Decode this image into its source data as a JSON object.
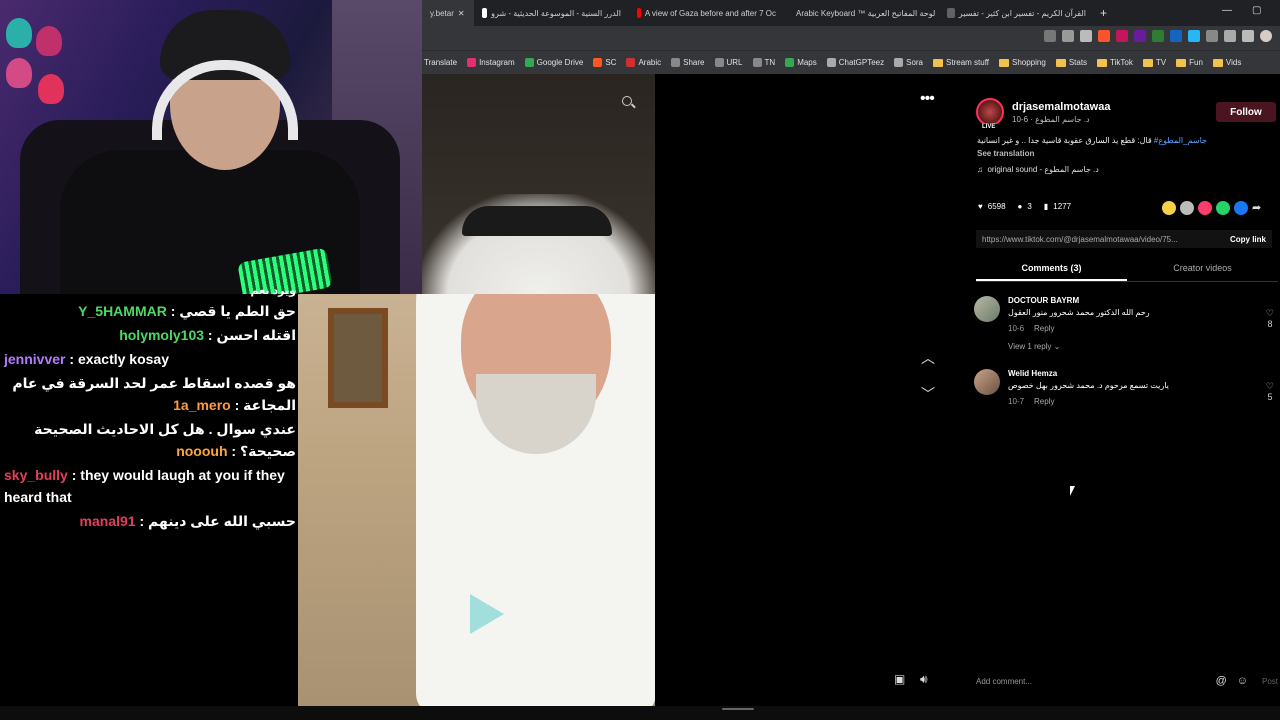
{
  "chat": {
    "partial_top": "ويرد نعم",
    "messages": [
      {
        "user": "Y_5HAMMAR",
        "user_color": "#4cd964",
        "text": "حق الطم يا قصي"
      },
      {
        "user": "holymoly103",
        "user_color": "#4cd964",
        "text": "اقتله احسن"
      },
      {
        "user": "jennivver",
        "user_color": "#b57bff",
        "text": "exactly kosay"
      },
      {
        "user": "1a_mero",
        "user_color": "#ff9b3d",
        "text": "هو قصده اسقاط عمر لحد السرقة في عام المجاعة"
      },
      {
        "user": "nooouh",
        "user_color": "#ffa53d",
        "text": "عندي سوال . هل كل الاحاديث الصحيحة صحيحة؟"
      },
      {
        "user": "sky_bully",
        "user_color": "#e0405a",
        "text": "they would laugh at you if they heard that"
      },
      {
        "user": "manal91",
        "user_color": "#e0405a",
        "text": "حسبي الله على دينهم"
      }
    ]
  },
  "browser": {
    "tabs": [
      {
        "label": "y.betar",
        "active": true
      },
      {
        "label": "الدرر السنية - الموسوعة الحديثية - شرو",
        "active": false
      },
      {
        "label": "A view of Gaza before and after 7 Oc",
        "active": false
      },
      {
        "label": "Arabic Keyboard ™ لوحة المفاتيح العربية",
        "active": false
      },
      {
        "label": "القرآن الكريم - تفسير ابن كثير - تفسير",
        "active": false
      }
    ],
    "new_tab": "+",
    "bookmarks": [
      "Translate",
      "Instagram",
      "Google Drive",
      "SC",
      "Arabic",
      "Share",
      "URL",
      "TN",
      "Maps",
      "ChatGPTeez",
      "Sora",
      "Stream stuff",
      "Shopping",
      "Stats",
      "TikTok",
      "TV",
      "Fun",
      "Vids"
    ]
  },
  "author": {
    "name": "drjasemalmotawaa",
    "meta": "10-6 · د. جاسم المطوع",
    "live": "LIVE",
    "follow": "Follow",
    "hashtag": "جاسم_المطوع#",
    "description": "قال: قطع يد السارق عقوبة قاسية جدا .. و غير انسانية",
    "see_translation": "See translation",
    "sound": "original sound - د. جاسم المطوع"
  },
  "stats": {
    "likes": "6598",
    "comments": "3",
    "saves": "1277"
  },
  "link": {
    "url": "https://www.tiktok.com/@drjasemalmotawaa/video/75...",
    "copy": "Copy link"
  },
  "tabs": {
    "comments": "Comments (3)",
    "creator_videos": "Creator videos"
  },
  "comments": [
    {
      "name": "DOCTOUR BAYRM",
      "text": "رحم الله الدكتور محمد شحرور منور العقول",
      "date": "10-6",
      "reply": "Reply",
      "likes": "8",
      "view_replies": "View 1 reply"
    },
    {
      "name": "Welid Hemza",
      "text": "ياريت تسمع مرحوم د. محمد شحرور بهل خصوص",
      "date": "10-7",
      "reply": "Reply",
      "likes": "5"
    }
  ],
  "add_comment": {
    "placeholder": "Add comment...",
    "post": "Post"
  }
}
